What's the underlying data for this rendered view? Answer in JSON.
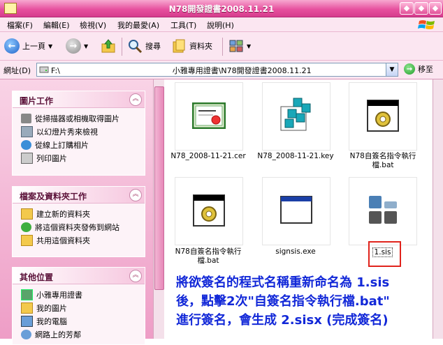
{
  "window": {
    "title": "N78開發證書2008.11.21"
  },
  "menu": [
    "檔案(F)",
    "編輯(E)",
    "檢視(V)",
    "我的最愛(A)",
    "工具(T)",
    "說明(H)"
  ],
  "toolbar": {
    "back": "上一頁",
    "search": "搜尋",
    "folders": "資料夾"
  },
  "address": {
    "label": "網址(D)",
    "path": "F:\\                                              小雅專用證書\\N78開發證書2008.11.21",
    "go": "移至"
  },
  "left_panels": [
    {
      "title": "圖片工作",
      "items": [
        "從掃描器或相機取得圖片",
        "以幻燈片秀來檢視",
        "從線上訂購相片",
        "列印圖片"
      ]
    },
    {
      "title": "檔案及資料夾工作",
      "items": [
        "建立新的資料夾",
        "將這個資料夾發佈到網站",
        "共用這個資料夾"
      ]
    },
    {
      "title": "其他位置",
      "items": [
        "小雅專用證書",
        "我的圖片",
        "我的電腦",
        "網路上的芳鄰"
      ]
    }
  ],
  "files": [
    {
      "name": "N78_2008-11-21.cer",
      "icon": "certificate-icon"
    },
    {
      "name": "N78_2008-11-21.key",
      "icon": "key-registry-icon"
    },
    {
      "name": "N78自簽名指令執行檔.bat",
      "icon": "batch-file-icon"
    },
    {
      "name": "N78自簽名指令執行檔.bat",
      "icon": "batch-file-icon"
    },
    {
      "name": "signsis.exe",
      "icon": "exe-window-icon"
    },
    {
      "name": "1.sis",
      "icon": "sis-package-icon"
    }
  ],
  "annotation": {
    "line1": "將欲簽名的程式名稱重新命名為 1.sis",
    "line2": "後，點擊2次\"自簽名指令執行檔.bat\"",
    "line3": "進行簽名，會生成 2.sisx (完成簽名)"
  },
  "colors": {
    "accent": "#e7519f",
    "annotation": "#1228d8",
    "highlight": "#e0231c"
  }
}
